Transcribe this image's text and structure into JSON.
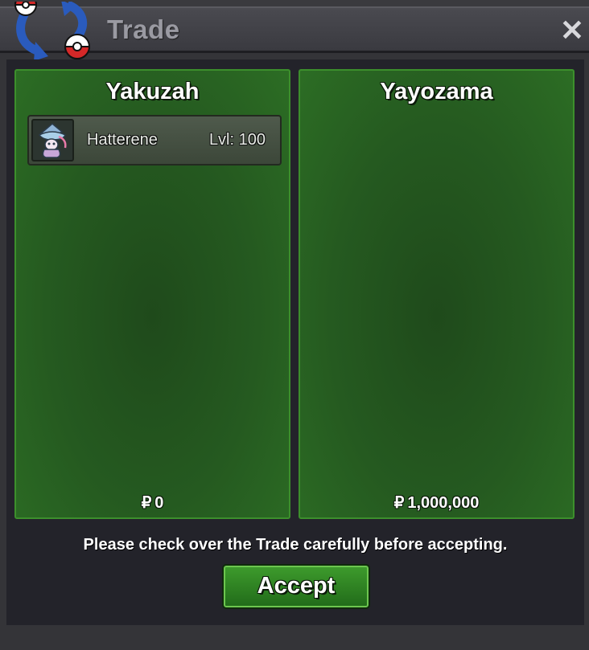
{
  "window": {
    "title": "Trade",
    "close_glyph": "✕",
    "icon": "trade-pokeball-arrows-icon"
  },
  "left_panel": {
    "player_name": "Yakuzah",
    "pokemon": [
      {
        "name": "Hatterene",
        "level": "Lvl: 100",
        "icon": "hatterene-sprite-icon"
      }
    ],
    "currency_symbol": "₽",
    "money": "0"
  },
  "right_panel": {
    "player_name": "Yayozama",
    "pokemon": [],
    "currency_symbol": "₽",
    "money": "1,000,000"
  },
  "notice": "Please check over the Trade carefully before accepting.",
  "accept_label": "Accept",
  "colors": {
    "panel_green": "#255a20",
    "panel_border": "#3c8f2c",
    "button_green": "#2f8423",
    "background": "#23232a"
  }
}
